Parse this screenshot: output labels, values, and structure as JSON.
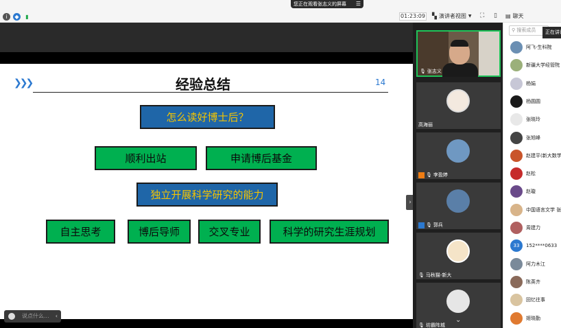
{
  "top_bar": {
    "share_banner": "您正在观看张志义的屏幕",
    "timer": "01:23:09",
    "view_label": "演讲者视图",
    "chat_label": "聊天"
  },
  "slide": {
    "title": "经验总结",
    "page_number": "14",
    "question": "怎么读好博士后？",
    "row1": [
      "顺利出站",
      "申请博后基金"
    ],
    "core": "独立开展科学研究的能力",
    "row3": [
      "自主思考",
      "博后导师",
      "交叉专业",
      "科学的研究生涯规划"
    ]
  },
  "chat_input": {
    "placeholder": "说点什么..."
  },
  "video_tiles": [
    {
      "name": "张志义"
    },
    {
      "name": "高海丽"
    },
    {
      "name": "李盈婷"
    },
    {
      "name": "郭兵"
    },
    {
      "name": "马秋猫-新大"
    },
    {
      "name": "坊霸阵城"
    }
  ],
  "participants": {
    "search_placeholder": "搜索成员",
    "speaking_label": "正在讲话",
    "list": [
      {
        "name": "阿飞-生科院",
        "avatar_color": "#6b8fb3"
      },
      {
        "name": "新疆大学经管院",
        "avatar_color": "#9bb07a"
      },
      {
        "name": "杨娟",
        "avatar_color": "#c7c7d6"
      },
      {
        "name": "杨圆圆",
        "avatar_color": "#1a1a1a"
      },
      {
        "name": "张晓玲",
        "avatar_color": "#e8e8e8"
      },
      {
        "name": "张旭峰",
        "avatar_color": "#444444"
      },
      {
        "name": "赵建平(新大数学",
        "avatar_color": "#c9552a"
      },
      {
        "name": "赵松",
        "avatar_color": "#c62b2b"
      },
      {
        "name": "赵璇",
        "avatar_color": "#6a4a8a"
      },
      {
        "name": "中国语言文学 张",
        "avatar_color": "#d8b48a"
      },
      {
        "name": "周建力",
        "avatar_color": "#b06060"
      },
      {
        "name": "152****0633",
        "avatar_color": "#2c79d0",
        "avatar_text": "33"
      },
      {
        "name": "阿力木江",
        "avatar_color": "#7a8a9a"
      },
      {
        "name": "陈英齐",
        "avatar_color": "#8a6a5a"
      },
      {
        "name": "回忆往事",
        "avatar_color": "#d9c4a0"
      },
      {
        "name": "姬晓勤",
        "avatar_color": "#e07a30"
      }
    ]
  }
}
